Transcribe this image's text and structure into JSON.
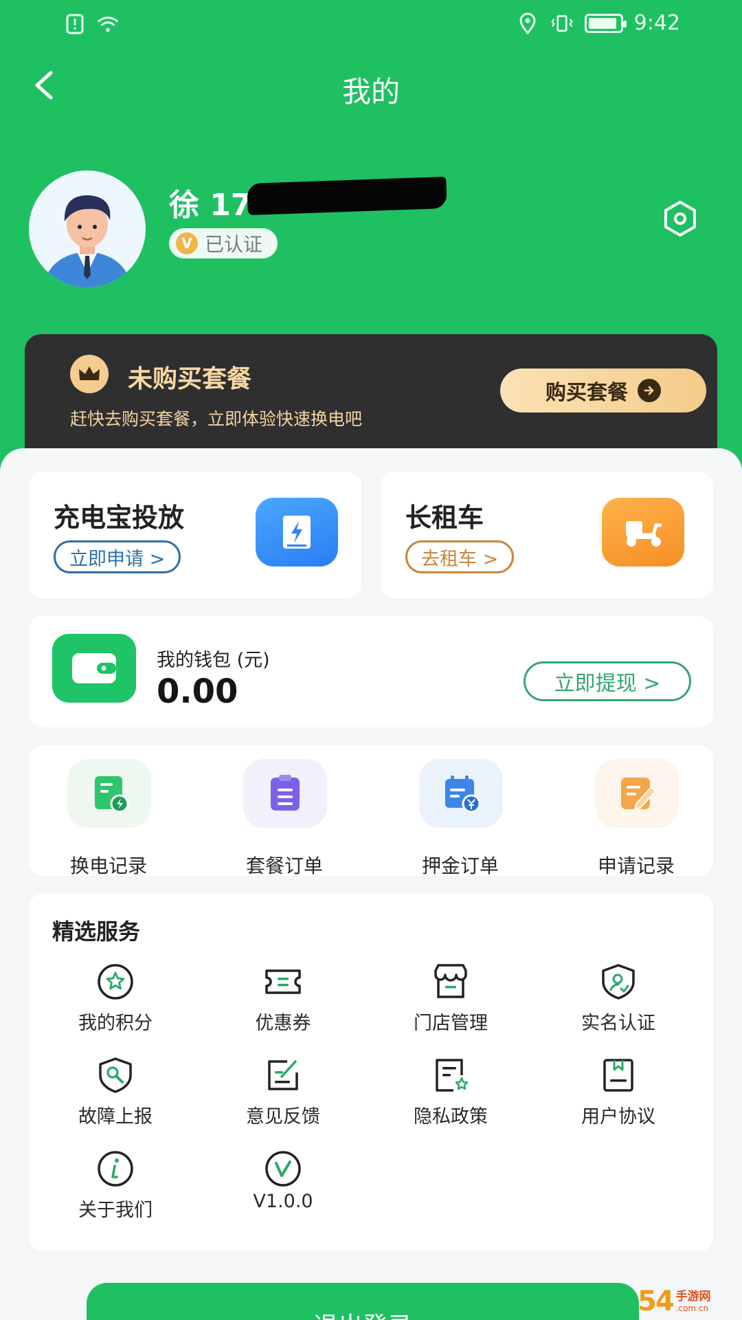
{
  "status_bar": {
    "time": "9:42",
    "battery_level": 0.9
  },
  "header": {
    "title": "我的"
  },
  "profile": {
    "name_prefix": "徐 17",
    "verified_label": "已认证",
    "verified_badge": "V"
  },
  "banner": {
    "title": "未购买套餐",
    "subtitle": "赶快去购买套餐，立即体验快速换电吧",
    "button_label": "购买套餐"
  },
  "promos": [
    {
      "title": "充电宝投放",
      "action": "立即申请 >"
    },
    {
      "title": "长租车",
      "action": "去租车 >"
    }
  ],
  "wallet": {
    "label": "我的钱包 (元)",
    "amount": "0.00",
    "action": "立即提现 >"
  },
  "quick_links": [
    {
      "label": "换电记录"
    },
    {
      "label": "套餐订单"
    },
    {
      "label": "押金订单"
    },
    {
      "label": "申请记录"
    }
  ],
  "services": {
    "title": "精选服务",
    "items": [
      {
        "label": "我的积分",
        "icon": "star-circle-icon"
      },
      {
        "label": "优惠券",
        "icon": "ticket-icon"
      },
      {
        "label": "门店管理",
        "icon": "store-icon"
      },
      {
        "label": "实名认证",
        "icon": "shield-user-icon"
      },
      {
        "label": "故障上报",
        "icon": "shield-wrench-icon"
      },
      {
        "label": "意见反馈",
        "icon": "edit-note-icon"
      },
      {
        "label": "隐私政策",
        "icon": "document-star-icon"
      },
      {
        "label": "用户协议",
        "icon": "bookmark-document-icon"
      },
      {
        "label": "关于我们",
        "icon": "info-circle-icon"
      },
      {
        "label": "V1.0.0",
        "icon": "version-v-icon"
      }
    ]
  },
  "logout": {
    "label": "退出登录"
  },
  "watermark": {
    "big": "54",
    "cn": "手游网",
    "en": ".com.cn"
  },
  "colors": {
    "brand_green": "#1fc062",
    "banner_dark": "#2f2f30",
    "gold": "#f7d8a3",
    "blue_accent": "#2d6fa6",
    "orange_accent": "#c9853a"
  }
}
